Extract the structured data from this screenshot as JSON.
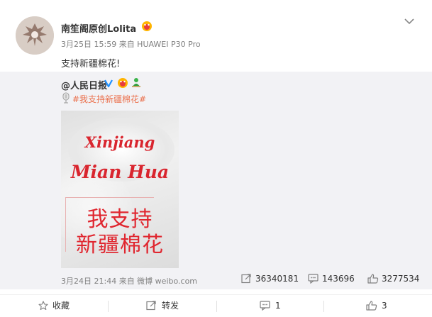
{
  "post": {
    "username": "南笙阁原创Lolita",
    "meta": "3月25日 15:59 来自 HUAWEI P30 Pro",
    "text": "支持新疆棉花!"
  },
  "repost": {
    "author": "@人民日报",
    "topic": "#我支持新疆棉花#",
    "image_text": {
      "line1": "Xinjiang",
      "line2": "Mian Hua",
      "line3": "我支持",
      "line4": "新疆棉花"
    },
    "date_source": "3月24日 21:44 来自 微博 weibo.com",
    "reposts": "36340181",
    "comments": "143696",
    "likes": "3277534"
  },
  "actions": {
    "favorite": "收藏",
    "repost": "转发",
    "comment": "1",
    "like": "3"
  },
  "colors": {
    "topic": "#eb7350",
    "verified": "#1e90ff",
    "image_text": "#d9252e"
  },
  "icons": [
    "dropdown-icon",
    "verified-icon",
    "vip-icon",
    "green-badge-icon",
    "mic-icon",
    "repost-stat-icon",
    "comment-stat-icon",
    "like-stat-icon",
    "star-icon",
    "repost-icon",
    "comment-icon",
    "like-icon"
  ]
}
